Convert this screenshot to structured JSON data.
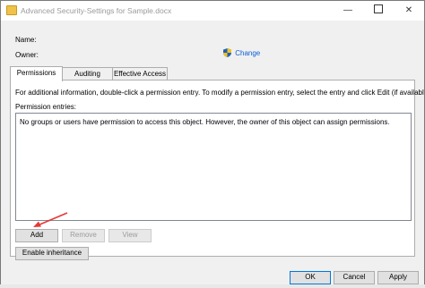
{
  "window": {
    "title": "Advanced Security-Settings for Sample.docx"
  },
  "titlebar": {
    "minimize": "—",
    "maximize": "",
    "close": "✕"
  },
  "info": {
    "name_label": "Name:",
    "owner_label": "Owner:",
    "change_link": "Change"
  },
  "tabs": [
    {
      "label": "Permissions",
      "selected": true
    },
    {
      "label": "Auditing",
      "selected": false
    },
    {
      "label": "Effective Access",
      "selected": false
    }
  ],
  "permissions": {
    "description": "For additional information, double-click a permission entry. To modify a permission entry, select the entry and click Edit (if available).",
    "entries_label": "Permission entries:",
    "empty_message": "No groups or users have permission to access this object. However, the owner of this object can assign permissions.",
    "add_label": "Add",
    "remove_label": "Remove",
    "view_label": "View",
    "enable_inheritance_label": "Enable inheritance"
  },
  "footer": {
    "ok_label": "OK",
    "cancel_label": "Cancel",
    "apply_label": "Apply"
  },
  "colors": {
    "link": "#0b5ed7",
    "annotation_arrow": "#e53935",
    "accent_border": "#0078d7"
  }
}
